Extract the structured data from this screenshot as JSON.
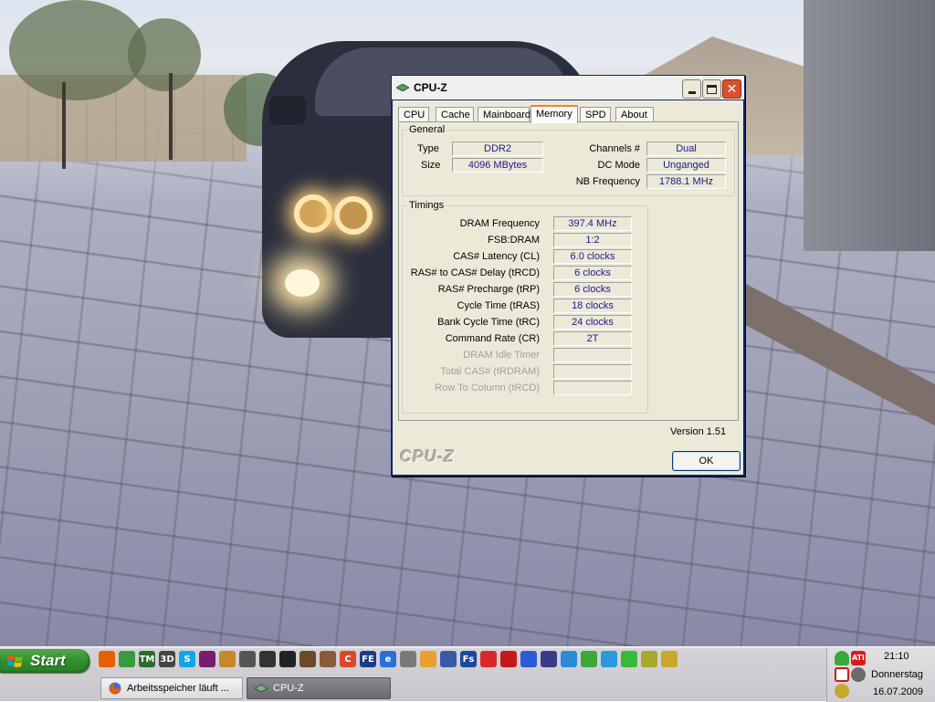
{
  "window": {
    "title": "CPU-Z",
    "tabs": [
      {
        "label": "CPU"
      },
      {
        "label": "Cache"
      },
      {
        "label": "Mainboard"
      },
      {
        "label": "Memory"
      },
      {
        "label": "SPD"
      },
      {
        "label": "About"
      }
    ],
    "active_tab": "Memory",
    "general": {
      "legend": "General",
      "type_label": "Type",
      "type_value": "DDR2",
      "size_label": "Size",
      "size_value": "4096 MBytes",
      "channels_label": "Channels #",
      "channels_value": "Dual",
      "dcmode_label": "DC Mode",
      "dcmode_value": "Unganged",
      "nbfreq_label": "NB Frequency",
      "nbfreq_value": "1788.1 MHz"
    },
    "timings": {
      "legend": "Timings",
      "rows": [
        {
          "label": "DRAM Frequency",
          "value": "397.4 MHz",
          "enabled": true
        },
        {
          "label": "FSB:DRAM",
          "value": "1:2",
          "enabled": true
        },
        {
          "label": "CAS# Latency (CL)",
          "value": "6.0 clocks",
          "enabled": true
        },
        {
          "label": "RAS# to CAS# Delay (tRCD)",
          "value": "6 clocks",
          "enabled": true
        },
        {
          "label": "RAS# Precharge (tRP)",
          "value": "6 clocks",
          "enabled": true
        },
        {
          "label": "Cycle Time (tRAS)",
          "value": "18 clocks",
          "enabled": true
        },
        {
          "label": "Bank Cycle Time (tRC)",
          "value": "24 clocks",
          "enabled": true
        },
        {
          "label": "Command Rate (CR)",
          "value": "2T",
          "enabled": true
        },
        {
          "label": "DRAM Idle Timer",
          "value": "",
          "enabled": false
        },
        {
          "label": "Total CAS# (tRDRAM)",
          "value": "",
          "enabled": false
        },
        {
          "label": "Row To Column (tRCD)",
          "value": "",
          "enabled": false
        }
      ]
    },
    "version": "Version 1.51",
    "brand": "CPU-Z",
    "ok_label": "OK"
  },
  "taskbar": {
    "start_label": "Start",
    "tasks": [
      {
        "label": "Arbeitsspeicher läuft ...",
        "icon": "firefox-icon"
      },
      {
        "label": "CPU-Z",
        "icon": "cpuz-icon"
      }
    ],
    "quick_launch": [
      {
        "icon": "firefox-icon",
        "color": "#e66000",
        "glyph": ""
      },
      {
        "icon": "messenger-icon",
        "color": "#3c9a3c",
        "glyph": ""
      },
      {
        "icon": "tm-icon",
        "color": "#2e6b2e",
        "glyph": "TM"
      },
      {
        "icon": "3dmark-icon",
        "color": "#444444",
        "glyph": "3D"
      },
      {
        "icon": "skype-icon",
        "color": "#12a5e6",
        "glyph": "S"
      },
      {
        "icon": "winrar-icon",
        "color": "#7a1c6e",
        "glyph": ""
      },
      {
        "icon": "cs-icon",
        "color": "#c48a2a",
        "glyph": ""
      },
      {
        "icon": "cs-source-icon",
        "color": "#555555",
        "glyph": ""
      },
      {
        "icon": "cs-icon-2",
        "color": "#333333",
        "glyph": ""
      },
      {
        "icon": "steam-icon",
        "color": "#222222",
        "glyph": ""
      },
      {
        "icon": "game-icon",
        "color": "#6b4a2a",
        "glyph": ""
      },
      {
        "icon": "game-icon-2",
        "color": "#8a5a3a",
        "glyph": ""
      },
      {
        "icon": "ccleaner-icon",
        "color": "#d84a2a",
        "glyph": "C"
      },
      {
        "icon": "fifa-icon",
        "color": "#1a3d8a",
        "glyph": "FE"
      },
      {
        "icon": "ie-icon",
        "color": "#2a6fd8",
        "glyph": "e"
      },
      {
        "icon": "firewall-icon",
        "color": "#7a7a7a",
        "glyph": ""
      },
      {
        "icon": "mail-icon",
        "color": "#e8a030",
        "glyph": ""
      },
      {
        "icon": "network-icon",
        "color": "#3a5aa8",
        "glyph": ""
      },
      {
        "icon": "fs-icon",
        "color": "#1a4a9a",
        "glyph": "Fs"
      },
      {
        "icon": "nero-icon",
        "color": "#d82a2a",
        "glyph": ""
      },
      {
        "icon": "acrobat-icon",
        "color": "#c41a1a",
        "glyph": ""
      },
      {
        "icon": "shield-icon",
        "color": "#2a5ad8",
        "glyph": ""
      },
      {
        "icon": "webcam-icon",
        "color": "#3a3a8a",
        "glyph": ""
      },
      {
        "icon": "media-player-icon",
        "color": "#2a8ad8",
        "glyph": ""
      },
      {
        "icon": "clover-icon",
        "color": "#3aa83a",
        "glyph": ""
      },
      {
        "icon": "camera-icon",
        "color": "#2a9ad8",
        "glyph": ""
      },
      {
        "icon": "utorrent-icon",
        "color": "#3ab83a",
        "glyph": ""
      },
      {
        "icon": "molecule-icon",
        "color": "#a8a82a",
        "glyph": ""
      },
      {
        "icon": "puzzle-icon",
        "color": "#c8a82a",
        "glyph": ""
      }
    ],
    "tray": {
      "time": "21:10",
      "day": "Donnerstag",
      "date": "16.07.2009",
      "icons": [
        {
          "icon": "user-icon",
          "color": "#3aa83a",
          "glyph": ""
        },
        {
          "icon": "ati-icon",
          "color": "#d81a1a",
          "glyph": "ATI"
        },
        {
          "icon": "antivirus-icon",
          "color": "#c81a1a",
          "glyph": ""
        },
        {
          "icon": "alert-icon",
          "color": "#6a6a6a",
          "glyph": ""
        },
        {
          "icon": "network-tray-icon",
          "color": "#c8a82a",
          "glyph": ""
        }
      ]
    }
  }
}
